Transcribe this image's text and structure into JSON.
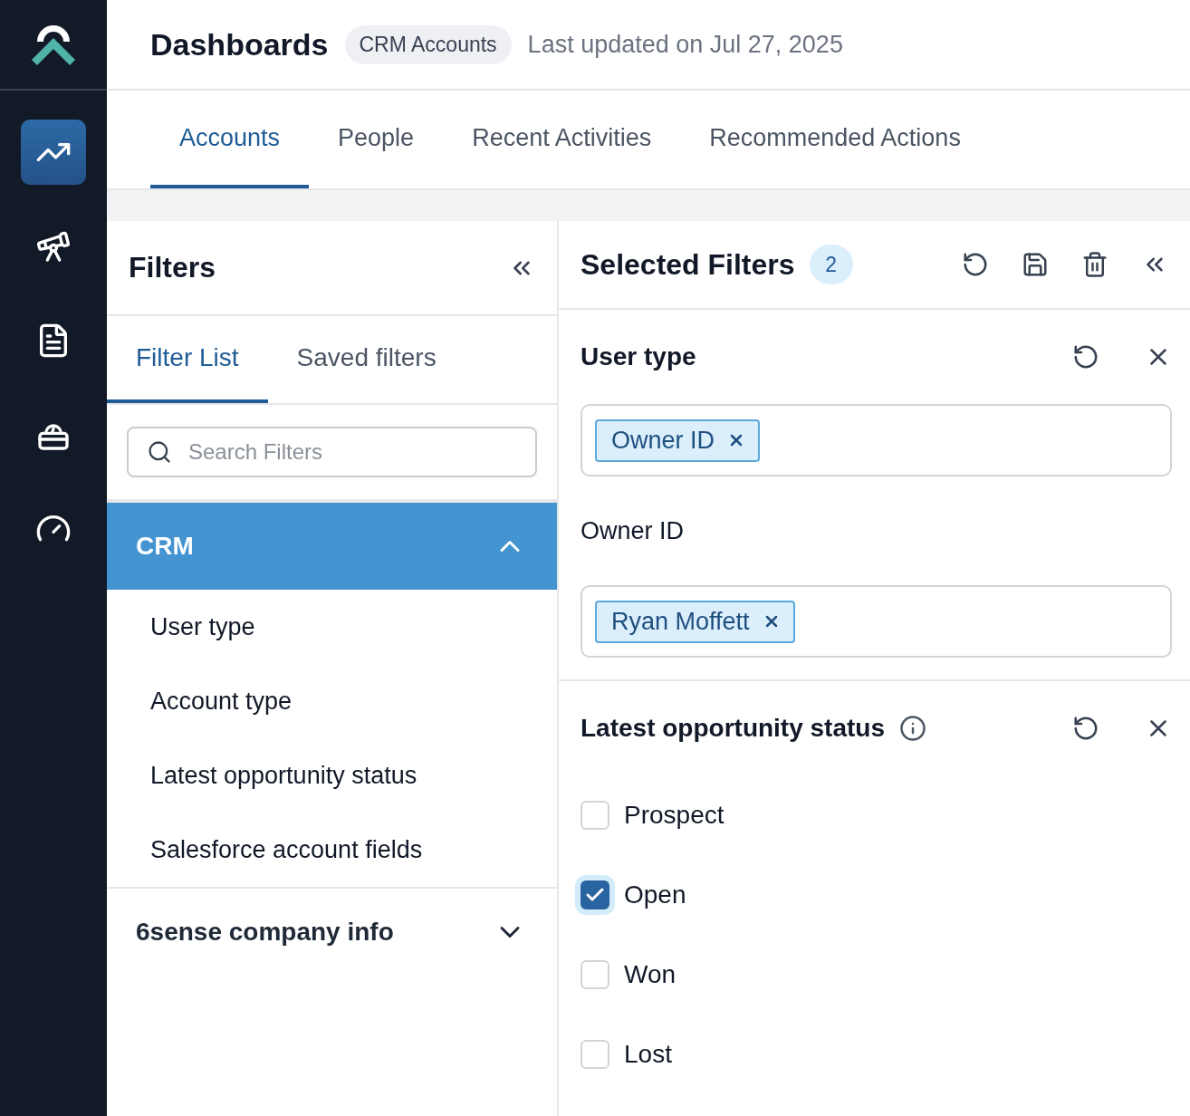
{
  "sidebar": {
    "items": [
      {
        "selected": true
      },
      {
        "selected": false
      },
      {
        "selected": false
      },
      {
        "selected": false
      },
      {
        "selected": false
      }
    ]
  },
  "header": {
    "title": "Dashboards",
    "badge": "CRM Accounts",
    "updated": "Last updated on Jul 27, 2025"
  },
  "tabs": [
    {
      "label": "Accounts",
      "selected": true
    },
    {
      "label": "People",
      "selected": false
    },
    {
      "label": "Recent Activities",
      "selected": false
    },
    {
      "label": "Recommended Actions",
      "selected": false
    }
  ],
  "filters": {
    "title": "Filters",
    "tabs": [
      {
        "label": "Filter List",
        "selected": true
      },
      {
        "label": "Saved filters",
        "selected": false
      }
    ],
    "search": {
      "placeholder": "Search Filters"
    },
    "groups": [
      {
        "label": "CRM",
        "expanded": true,
        "children": [
          {
            "label": "User type"
          },
          {
            "label": "Account type"
          },
          {
            "label": "Latest opportunity status"
          },
          {
            "label": "Salesforce account fields"
          }
        ]
      },
      {
        "label": "6sense company info",
        "expanded": false
      }
    ]
  },
  "selected_filters": {
    "title": "Selected Filters",
    "count": "2",
    "sections": [
      {
        "kind": "tags",
        "title": "User type",
        "info": false,
        "fields": [
          {
            "tags": [
              "Owner ID"
            ]
          },
          {
            "label": "Owner ID",
            "tags": [
              "Ryan Moffett"
            ]
          }
        ]
      },
      {
        "kind": "checkboxes",
        "title": "Latest opportunity status",
        "info": true,
        "options": [
          {
            "label": "Prospect",
            "checked": false
          },
          {
            "label": "Open",
            "checked": true
          },
          {
            "label": "Won",
            "checked": false
          },
          {
            "label": "Lost",
            "checked": false
          }
        ]
      }
    ]
  }
}
